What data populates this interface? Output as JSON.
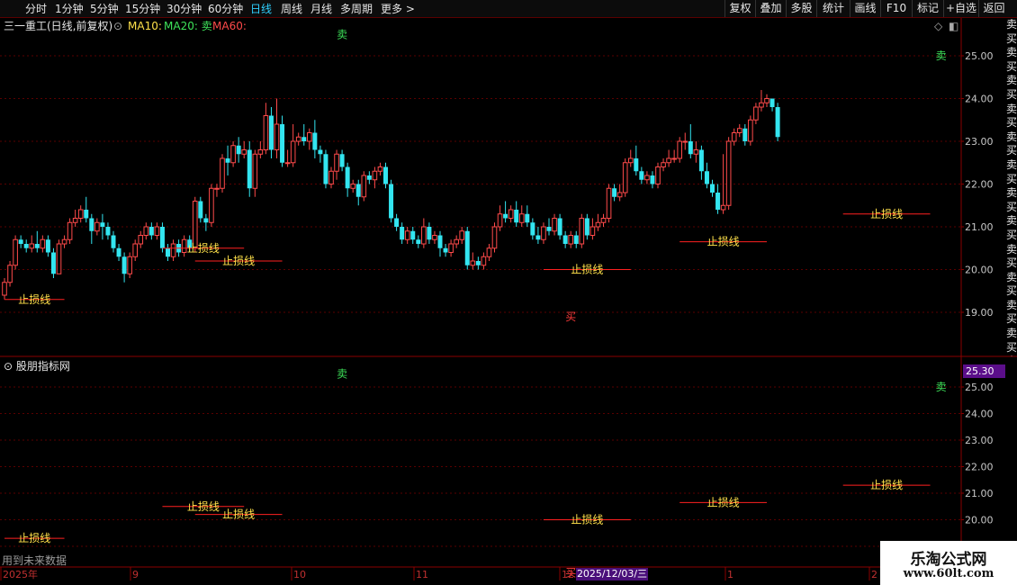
{
  "toolbar": {
    "tabs": [
      "分时",
      "1分钟",
      "5分钟",
      "15分钟",
      "30分钟",
      "60分钟",
      "日线",
      "周线",
      "月线",
      "多周期",
      "更多 >"
    ],
    "active_tab": "日线",
    "right_buttons": [
      "复权",
      "叠加",
      "多股",
      "统计",
      "画线",
      "F10",
      "标记",
      "+自选",
      "返回"
    ]
  },
  "header": {
    "stock_title": "三一重工(日线,前复权)",
    "ma10": "MA10:",
    "ma20": "MA20: 卖",
    "ma60": "MA60:"
  },
  "side_column_text": "卖买卖买卖买卖买卖买卖买卖买卖买卖买卖买卖买卖买卖买卖买卖买卖买",
  "lower_panel": {
    "label": "股朋指标网",
    "price_box": "25.30",
    "future_note": "用到未来数据",
    "date_box": "2025/12/03/三"
  },
  "watermark": {
    "line1": "乐淘公式网",
    "line2": "www.60lt.com"
  },
  "signals": {
    "sell_label": "卖",
    "buy_label": "买",
    "stop_label": "止损线"
  },
  "colors": {
    "up": "#ff4a4a",
    "down": "#33e5f0",
    "stop_line": "#ff2020",
    "stop_text": "#ffe14a",
    "sell": "#3ee35a",
    "buy": "#ff3b3b",
    "grid": "#5a0000",
    "active_tab": "#2fd0ff"
  },
  "chart_data": {
    "type": "candlestick",
    "y_labels": [
      25.0,
      24.0,
      23.0,
      22.0,
      21.0,
      20.0,
      19.0
    ],
    "ylim": [
      18.3,
      25.8
    ],
    "x_labels": [
      "2025年",
      "9",
      "10",
      "11",
      "12",
      "1",
      "2"
    ],
    "candles": [
      [
        19.4,
        19.7,
        19.3,
        19.8
      ],
      [
        19.7,
        20.1,
        19.6,
        20.2
      ],
      [
        20.1,
        20.7,
        20.0,
        20.8
      ],
      [
        20.7,
        20.6,
        20.5,
        20.8
      ],
      [
        20.6,
        20.5,
        20.4,
        20.7
      ],
      [
        20.5,
        20.6,
        20.4,
        20.8
      ],
      [
        20.6,
        20.5,
        20.4,
        20.9
      ],
      [
        20.5,
        20.7,
        20.4,
        20.8
      ],
      [
        20.7,
        20.4,
        20.3,
        20.8
      ],
      [
        20.4,
        19.9,
        19.8,
        20.5
      ],
      [
        19.9,
        20.6,
        19.9,
        20.7
      ],
      [
        20.6,
        20.7,
        20.5,
        20.8
      ],
      [
        20.7,
        21.1,
        20.6,
        21.2
      ],
      [
        21.1,
        21.2,
        21.0,
        21.4
      ],
      [
        21.2,
        21.4,
        21.1,
        21.5
      ],
      [
        21.4,
        21.2,
        21.1,
        21.7
      ],
      [
        21.2,
        20.9,
        20.6,
        21.3
      ],
      [
        20.9,
        21.1,
        20.8,
        21.2
      ],
      [
        21.1,
        21.0,
        20.7,
        21.3
      ],
      [
        21.0,
        20.8,
        20.7,
        21.1
      ],
      [
        20.8,
        20.5,
        20.4,
        20.9
      ],
      [
        20.5,
        20.3,
        20.2,
        20.6
      ],
      [
        20.3,
        19.9,
        19.7,
        20.4
      ],
      [
        19.9,
        20.3,
        19.8,
        20.4
      ],
      [
        20.3,
        20.6,
        20.2,
        20.7
      ],
      [
        20.6,
        20.8,
        20.5,
        20.9
      ],
      [
        20.8,
        21.0,
        20.7,
        21.1
      ],
      [
        21.0,
        20.8,
        20.7,
        21.1
      ],
      [
        20.8,
        21.0,
        20.7,
        21.1
      ],
      [
        21.0,
        20.5,
        20.4,
        21.1
      ],
      [
        20.5,
        20.3,
        20.2,
        20.6
      ],
      [
        20.3,
        20.6,
        20.2,
        20.7
      ],
      [
        20.6,
        20.4,
        20.3,
        20.7
      ],
      [
        20.4,
        20.7,
        20.3,
        20.8
      ],
      [
        20.7,
        20.5,
        20.4,
        20.8
      ],
      [
        20.5,
        21.6,
        20.4,
        21.7
      ],
      [
        21.6,
        21.2,
        21.1,
        21.7
      ],
      [
        21.2,
        21.1,
        20.9,
        21.3
      ],
      [
        21.1,
        21.9,
        21.0,
        22.0
      ],
      [
        21.9,
        21.9,
        21.7,
        22.0
      ],
      [
        21.9,
        22.6,
        21.8,
        22.7
      ],
      [
        22.6,
        22.5,
        22.2,
        22.9
      ],
      [
        22.5,
        22.9,
        22.4,
        23.0
      ],
      [
        22.9,
        22.7,
        22.5,
        23.1
      ],
      [
        22.7,
        22.8,
        22.6,
        23.0
      ],
      [
        22.8,
        21.9,
        21.7,
        23.0
      ],
      [
        21.9,
        22.7,
        21.7,
        22.8
      ],
      [
        22.7,
        22.8,
        22.6,
        23.0
      ],
      [
        22.8,
        23.6,
        22.7,
        23.9
      ],
      [
        23.6,
        22.8,
        22.6,
        23.8
      ],
      [
        22.8,
        23.4,
        22.6,
        24.0
      ],
      [
        23.4,
        22.5,
        22.4,
        23.6
      ],
      [
        22.5,
        22.5,
        22.4,
        22.8
      ],
      [
        22.5,
        23.0,
        22.4,
        23.4
      ],
      [
        23.0,
        23.1,
        22.9,
        23.2
      ],
      [
        23.1,
        23.0,
        22.9,
        23.4
      ],
      [
        23.0,
        23.2,
        22.8,
        23.3
      ],
      [
        23.2,
        22.8,
        22.6,
        23.5
      ],
      [
        22.8,
        22.7,
        22.5,
        22.9
      ],
      [
        22.7,
        22.0,
        21.9,
        22.8
      ],
      [
        22.0,
        22.3,
        21.9,
        22.4
      ],
      [
        22.3,
        22.7,
        22.1,
        22.8
      ],
      [
        22.7,
        22.4,
        22.3,
        22.8
      ],
      [
        22.4,
        21.9,
        21.7,
        22.5
      ],
      [
        21.9,
        22.0,
        21.8,
        22.1
      ],
      [
        22.0,
        21.7,
        21.5,
        22.1
      ],
      [
        21.7,
        22.2,
        21.6,
        22.3
      ],
      [
        22.2,
        22.1,
        22.0,
        22.3
      ],
      [
        22.1,
        22.3,
        21.9,
        22.4
      ],
      [
        22.3,
        22.4,
        22.2,
        22.5
      ],
      [
        22.4,
        22.0,
        21.9,
        22.5
      ],
      [
        22.0,
        21.2,
        21.1,
        22.1
      ],
      [
        21.2,
        21.0,
        20.9,
        21.3
      ],
      [
        21.0,
        20.7,
        20.6,
        21.1
      ],
      [
        20.7,
        20.9,
        20.6,
        21.0
      ],
      [
        20.9,
        20.7,
        20.6,
        21.0
      ],
      [
        20.7,
        20.6,
        20.5,
        20.8
      ],
      [
        20.6,
        21.0,
        20.5,
        21.2
      ],
      [
        21.0,
        20.7,
        20.6,
        21.1
      ],
      [
        20.7,
        20.8,
        20.6,
        20.9
      ],
      [
        20.8,
        20.5,
        20.3,
        20.9
      ],
      [
        20.5,
        20.4,
        20.3,
        20.6
      ],
      [
        20.4,
        20.6,
        20.3,
        20.7
      ],
      [
        20.6,
        20.7,
        20.5,
        20.8
      ],
      [
        20.7,
        20.9,
        20.6,
        21.0
      ],
      [
        20.9,
        20.1,
        20.0,
        21.0
      ],
      [
        20.1,
        20.2,
        20.0,
        20.4
      ],
      [
        20.2,
        20.1,
        20.0,
        20.3
      ],
      [
        20.1,
        20.3,
        20.0,
        20.4
      ],
      [
        20.3,
        20.5,
        20.2,
        20.6
      ],
      [
        20.5,
        21.0,
        20.4,
        21.1
      ],
      [
        21.0,
        21.3,
        20.9,
        21.5
      ],
      [
        21.3,
        21.2,
        21.1,
        21.6
      ],
      [
        21.2,
        21.4,
        21.1,
        21.5
      ],
      [
        21.4,
        21.1,
        21.0,
        21.6
      ],
      [
        21.1,
        21.3,
        21.0,
        21.5
      ],
      [
        21.3,
        21.1,
        21.0,
        21.5
      ],
      [
        21.1,
        20.8,
        20.7,
        21.2
      ],
      [
        20.8,
        20.7,
        20.6,
        21.0
      ],
      [
        20.7,
        21.0,
        20.6,
        21.1
      ],
      [
        21.0,
        20.9,
        20.8,
        21.2
      ],
      [
        20.9,
        21.2,
        20.8,
        21.3
      ],
      [
        21.2,
        20.8,
        20.7,
        21.3
      ],
      [
        20.8,
        20.6,
        20.5,
        20.9
      ],
      [
        20.6,
        20.8,
        20.5,
        20.9
      ],
      [
        20.8,
        20.6,
        20.5,
        20.9
      ],
      [
        20.6,
        21.2,
        20.5,
        21.3
      ],
      [
        21.2,
        20.8,
        20.7,
        21.3
      ],
      [
        20.8,
        21.0,
        20.7,
        21.2
      ],
      [
        21.0,
        21.1,
        20.9,
        21.3
      ],
      [
        21.1,
        21.2,
        21.0,
        21.3
      ],
      [
        21.2,
        21.9,
        21.1,
        22.0
      ],
      [
        21.9,
        21.7,
        21.6,
        22.0
      ],
      [
        21.7,
        21.8,
        21.6,
        22.0
      ],
      [
        21.8,
        22.5,
        21.7,
        22.6
      ],
      [
        22.5,
        22.6,
        22.4,
        22.8
      ],
      [
        22.6,
        22.3,
        22.2,
        22.9
      ],
      [
        22.3,
        22.1,
        22.0,
        22.4
      ],
      [
        22.1,
        22.2,
        22.0,
        22.3
      ],
      [
        22.2,
        22.0,
        21.9,
        22.3
      ],
      [
        22.0,
        22.4,
        21.9,
        22.5
      ],
      [
        22.4,
        22.5,
        22.3,
        22.6
      ],
      [
        22.5,
        22.6,
        22.4,
        22.8
      ],
      [
        22.6,
        22.6,
        22.5,
        22.8
      ],
      [
        22.6,
        23.0,
        22.5,
        23.1
      ],
      [
        23.0,
        23.0,
        22.8,
        23.2
      ],
      [
        23.0,
        22.7,
        22.6,
        23.4
      ],
      [
        22.7,
        22.8,
        22.5,
        23.0
      ],
      [
        22.8,
        22.3,
        22.1,
        22.9
      ],
      [
        22.3,
        22.0,
        21.9,
        22.5
      ],
      [
        22.0,
        21.8,
        21.7,
        22.1
      ],
      [
        21.8,
        21.4,
        21.3,
        22.0
      ],
      [
        21.4,
        21.5,
        21.3,
        22.7
      ],
      [
        21.5,
        23.0,
        21.4,
        23.1
      ],
      [
        23.0,
        23.2,
        22.9,
        23.3
      ],
      [
        23.2,
        23.3,
        23.1,
        23.4
      ],
      [
        23.3,
        23.0,
        22.9,
        23.4
      ],
      [
        23.0,
        23.5,
        22.9,
        23.6
      ],
      [
        23.5,
        23.8,
        23.4,
        23.9
      ],
      [
        23.8,
        23.9,
        23.7,
        24.2
      ],
      [
        23.9,
        24.0,
        23.8,
        24.1
      ],
      [
        24.0,
        23.8,
        23.7,
        24.0
      ],
      [
        23.8,
        23.1,
        23.0,
        23.9
      ]
    ],
    "stop_lines": [
      {
        "price": 19.3,
        "i0": 0,
        "i1": 11
      },
      {
        "price": 20.5,
        "i0": 29,
        "i1": 44
      },
      {
        "price": 20.2,
        "i0": 35,
        "i1": 51
      },
      {
        "price": 20.0,
        "i0": 99,
        "i1": 115
      },
      {
        "price": 20.65,
        "i0": 124,
        "i1": 140
      },
      {
        "price": 21.3,
        "i0": 154,
        "i1": 170
      }
    ],
    "sell_signals": [
      {
        "i": 62,
        "price": 25.5
      },
      {
        "i": 172,
        "price": 25.0
      }
    ],
    "buy_signals": [
      {
        "i": 104,
        "price": 18.9
      }
    ]
  }
}
